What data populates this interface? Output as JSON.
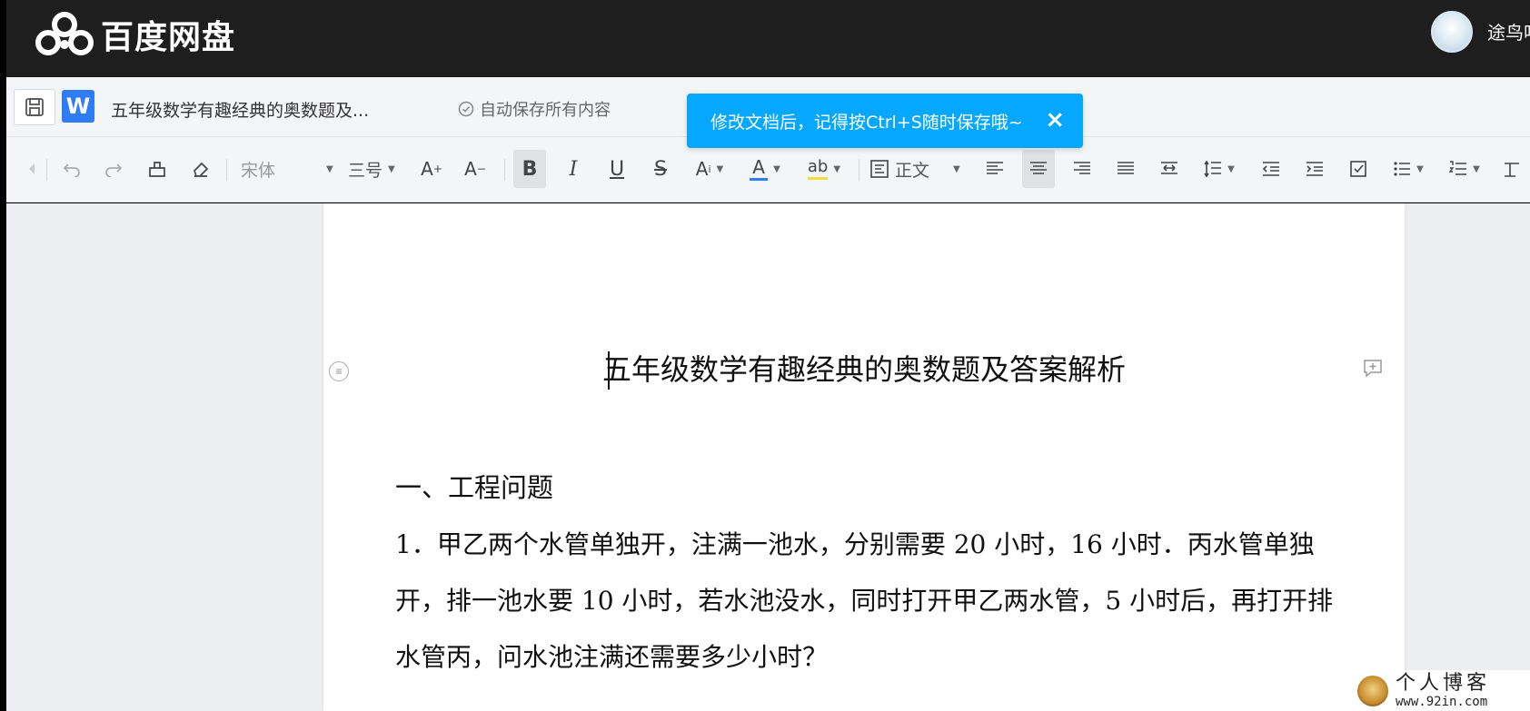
{
  "app": {
    "name": "百度网盘",
    "user": "途鸟吧"
  },
  "document": {
    "short_title": "五年级数学有趣经典的奥数题及...",
    "autosave_text": "自动保存所有内容"
  },
  "toast": {
    "message": "修改文档后，记得按Ctrl+S随时保存哦~",
    "close_icon": "×"
  },
  "toolbar": {
    "font_family": "宋体",
    "font_size": "三号",
    "paragraph_style": "正文",
    "bold_label": "B",
    "italic_label": "I",
    "underline_label": "U",
    "strike_label": "S",
    "font_color_hex": "#2e7cf6",
    "highlight_color_hex": "#f0e040"
  },
  "content": {
    "title": "五年级数学有趣经典的奥数题及答案解析",
    "section_heading": "一、工程问题",
    "paragraph_1": "1．甲乙两个水管单独开，注满一池水，分别需要 20 小时，16 小时．丙水管单独开，排一池水要 10 小时，若水池没水，同时打开甲乙两水管，5 小时后，再打开排水管丙，问水池注满还需要多少小时？"
  },
  "watermark": {
    "title": "个人博客",
    "url": "www.92in.com"
  },
  "colors": {
    "topbar_bg": "#1e1e1e",
    "toast_bg": "#06a7ff",
    "word_icon_bg": "#2e7cf6"
  }
}
